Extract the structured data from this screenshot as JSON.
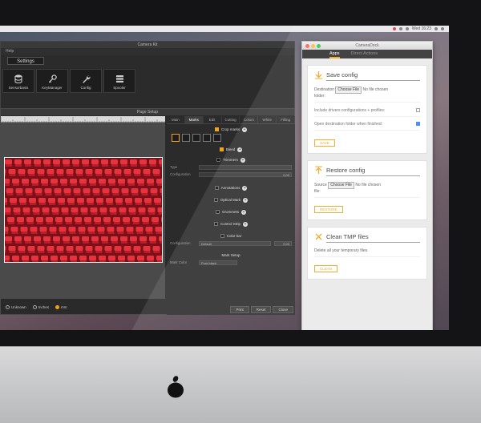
{
  "menubar": {
    "clock": "Wed 16:23"
  },
  "camera_window": {
    "title": "Camera Kit",
    "menu_help": "Help",
    "settings_tab": "Settings",
    "toolbar": [
      {
        "label": "Sensorbasis",
        "icon": "database-icon"
      },
      {
        "label": "KeyManager",
        "icon": "key-icon"
      },
      {
        "label": "Config",
        "icon": "wrench-icon"
      },
      {
        "label": "Spooler",
        "icon": "list-icon"
      }
    ]
  },
  "page_setup": {
    "title": "Page Setup",
    "tabs": [
      "Main",
      "Marks",
      "Edit",
      "Cutting",
      "Colors",
      "White",
      "Filling"
    ],
    "active_tab": "Marks",
    "sections": {
      "crop_marks": "Crop marks",
      "bleed": "Bleed",
      "trimmers": "Trimmers",
      "annotations": "Annotations",
      "optical_mark": "Optical Mark",
      "grommets": "Grommets",
      "control_strip": "Control Strip",
      "color_bar": "Color bar",
      "mark_setup": "Mark Setup"
    },
    "fields": {
      "type_label": "Type",
      "configuration_label": "Configuration",
      "configuration_value": "0,00",
      "configuration2_label": "Configuration",
      "configuration2_value": "Default",
      "configuration2_num": "0,00",
      "mark_color_label": "Mark Color",
      "mark_color_value": "Pure black"
    },
    "units": [
      "Unknown",
      "Inches",
      "mm"
    ],
    "units_selected": "mm",
    "buttons": {
      "print": "Print",
      "reset": "Reset",
      "close": "Close"
    }
  },
  "dock": {
    "title": "CameraDock",
    "tabs": [
      "Apps",
      "Direct Actions"
    ],
    "active_tab": "Apps",
    "save": {
      "title": "Save config",
      "destination_label": "Destination",
      "choose_btn": "Choose File",
      "no_file": "No file chosen",
      "folder_label": "folder:",
      "opt1": "Include drivers configurations + profiles:",
      "opt1_checked": false,
      "opt2": "Open destination folder when finished:",
      "opt2_checked": true,
      "action": "SAVE"
    },
    "restore": {
      "title": "Restore config",
      "source_label": "Source",
      "choose_btn": "Choose File",
      "no_file": "No file chosen",
      "file_label": "file:",
      "action": "RESTORE"
    },
    "clean": {
      "title": "Clean TMP files",
      "desc": "Delete all your temporary files.",
      "action": "CLEAN"
    },
    "accent": "#f2a31b"
  }
}
